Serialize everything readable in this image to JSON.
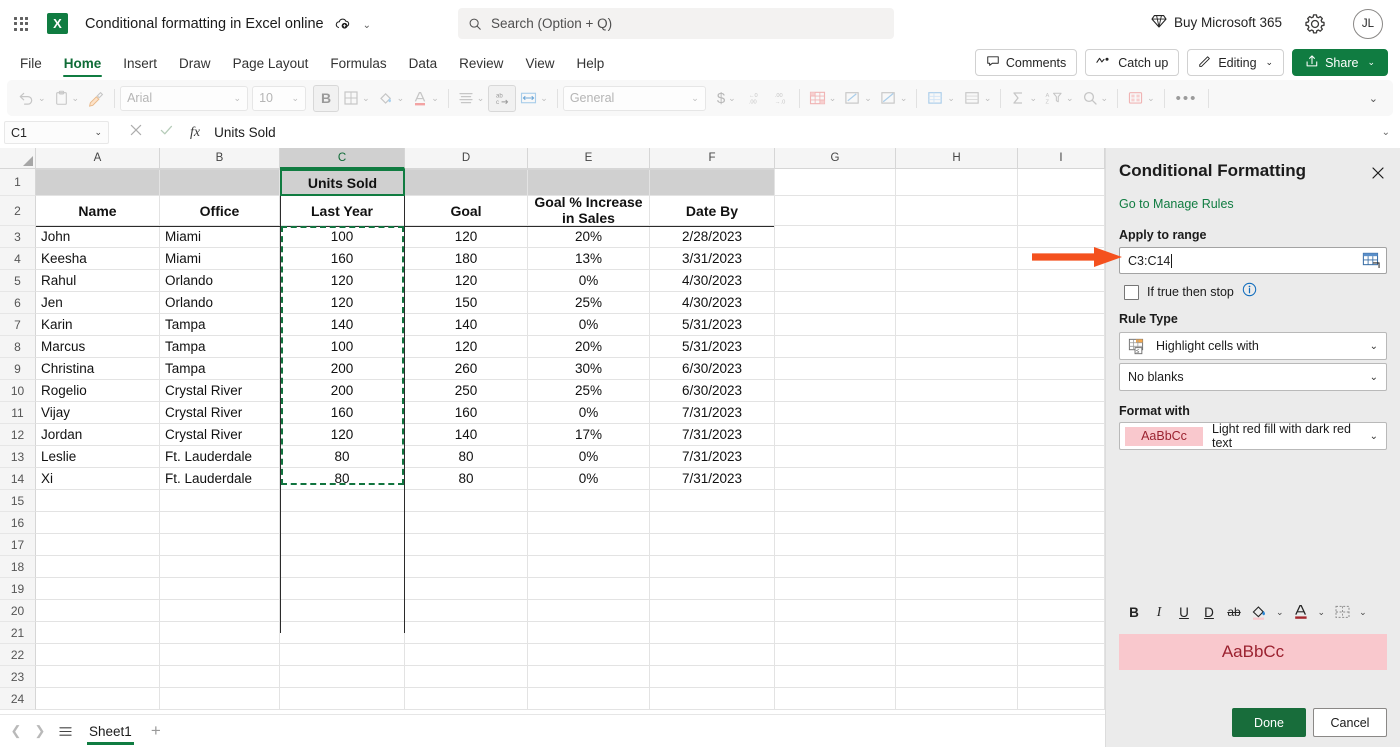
{
  "titlebar": {
    "app_launcher": "waffle-icon",
    "app_icon_letter": "X",
    "doc_title": "Conditional formatting in Excel online",
    "autosave_icon": "autosave-cloud-icon",
    "title_chevron": "⌄",
    "search_placeholder": "Search (Option + Q)",
    "buy_label": "Buy Microsoft 365",
    "settings_icon": "gear-icon",
    "avatar_initials": "JL"
  },
  "ribbon": {
    "tabs": [
      {
        "label": "File",
        "active": false
      },
      {
        "label": "Home",
        "active": true
      },
      {
        "label": "Insert",
        "active": false
      },
      {
        "label": "Draw",
        "active": false
      },
      {
        "label": "Page Layout",
        "active": false
      },
      {
        "label": "Formulas",
        "active": false
      },
      {
        "label": "Data",
        "active": false
      },
      {
        "label": "Review",
        "active": false
      },
      {
        "label": "View",
        "active": false
      },
      {
        "label": "Help",
        "active": false
      }
    ],
    "comments_label": "Comments",
    "catchup_label": "Catch up",
    "editing_label": "Editing",
    "share_label": "Share"
  },
  "toolbar": {
    "font_name": "Arial",
    "font_size": "10",
    "bold_label": "B",
    "number_format": "General",
    "currency_symbol": "$",
    "overflow_label": "•••",
    "collapse_chevron": "⌄"
  },
  "formula_bar": {
    "name_box": "C1",
    "cancel_icon": "cancel-x-icon",
    "confirm_icon": "confirm-check-icon",
    "fx_label": "fx",
    "formula_value": "Units Sold",
    "expand_chevron": "⌄"
  },
  "grid": {
    "columns": [
      "A",
      "B",
      "C",
      "D",
      "E",
      "F",
      "G",
      "H",
      "I"
    ],
    "selected_column": "C",
    "row_numbers": [
      "1",
      "2",
      "3",
      "4",
      "5",
      "6",
      "7",
      "8",
      "9",
      "10",
      "11",
      "12",
      "13",
      "14",
      "15",
      "16",
      "17",
      "18",
      "19",
      "20",
      "21",
      "22",
      "23",
      "24"
    ],
    "active_cell_ref": "C1",
    "active_cell_value": "Units Sold",
    "headers": {
      "a": "Name",
      "b": "Office",
      "c": "Last Year",
      "d": "Goal",
      "e_line1": "Goal % Increase",
      "e_line2": "in Sales",
      "f": "Date By"
    },
    "rows": [
      {
        "name": "John",
        "office": "Miami",
        "last_year": "100",
        "goal": "120",
        "increase": "20%",
        "date_by": "2/28/2023"
      },
      {
        "name": "Keesha",
        "office": "Miami",
        "last_year": "160",
        "goal": "180",
        "increase": "13%",
        "date_by": "3/31/2023"
      },
      {
        "name": "Rahul",
        "office": "Orlando",
        "last_year": "120",
        "goal": "120",
        "increase": "0%",
        "date_by": "4/30/2023"
      },
      {
        "name": "Jen",
        "office": "Orlando",
        "last_year": "120",
        "goal": "150",
        "increase": "25%",
        "date_by": "4/30/2023"
      },
      {
        "name": "Karin",
        "office": "Tampa",
        "last_year": "140",
        "goal": "140",
        "increase": "0%",
        "date_by": "5/31/2023"
      },
      {
        "name": "Marcus",
        "office": "Tampa",
        "last_year": "100",
        "goal": "120",
        "increase": "20%",
        "date_by": "5/31/2023"
      },
      {
        "name": "Christina",
        "office": "Tampa",
        "last_year": "200",
        "goal": "260",
        "increase": "30%",
        "date_by": "6/30/2023"
      },
      {
        "name": "Rogelio",
        "office": "Crystal River",
        "last_year": "200",
        "goal": "250",
        "increase": "25%",
        "date_by": "6/30/2023"
      },
      {
        "name": "Vijay",
        "office": "Crystal River",
        "last_year": "160",
        "goal": "160",
        "increase": "0%",
        "date_by": "7/31/2023"
      },
      {
        "name": "Jordan",
        "office": "Crystal River",
        "last_year": "120",
        "goal": "140",
        "increase": "17%",
        "date_by": "7/31/2023"
      },
      {
        "name": "Leslie",
        "office": "Ft. Lauderdale",
        "last_year": "80",
        "goal": "80",
        "increase": "0%",
        "date_by": "7/31/2023"
      },
      {
        "name": "Xi",
        "office": "Ft. Lauderdale",
        "last_year": "80",
        "goal": "80",
        "increase": "0%",
        "date_by": "7/31/2023"
      }
    ]
  },
  "sheetbar": {
    "prev_icon": "chevron-left-icon",
    "next_icon": "chevron-right-icon",
    "all_sheets_icon": "hamburger-icon",
    "tabs": [
      {
        "label": "Sheet1",
        "active": true
      }
    ],
    "add_label": "+"
  },
  "panel": {
    "title": "Conditional Formatting",
    "close_icon": "close-icon",
    "manage_rules_link": "Go to Manage Rules",
    "apply_to_range_label": "Apply to range",
    "apply_to_range_value": "C3:C14",
    "range_picker_icon": "range-picker-icon",
    "if_true_stop_label": "If true then stop",
    "info_icon": "info-icon",
    "rule_type_label": "Rule Type",
    "rule_type_value": "Highlight cells with",
    "rule_type_icon": "highlight-cells-icon",
    "condition_value": "No blanks",
    "format_with_label": "Format with",
    "format_swatch_text": "AaBbCc",
    "format_with_value": "Light red fill with dark red text",
    "format_tools": [
      {
        "name": "bold",
        "glyph": "B"
      },
      {
        "name": "italic",
        "glyph": "I"
      },
      {
        "name": "underline",
        "glyph": "U"
      },
      {
        "name": "double-underline",
        "glyph": "D"
      },
      {
        "name": "strikethrough",
        "glyph": "ab"
      },
      {
        "name": "fill-color",
        "glyph": "fill"
      },
      {
        "name": "font-color",
        "glyph": "A"
      },
      {
        "name": "borders",
        "glyph": "borders"
      }
    ],
    "preview_text": "AaBbCc",
    "done_label": "Done",
    "cancel_label": "Cancel",
    "accent_green": "#107c41",
    "fill_pink": "#f9c8cd",
    "text_dark_red": "#9b2230"
  },
  "annotation": {
    "arrow_icon": "orange-arrow-right-icon",
    "arrow_color": "#f4511e"
  }
}
